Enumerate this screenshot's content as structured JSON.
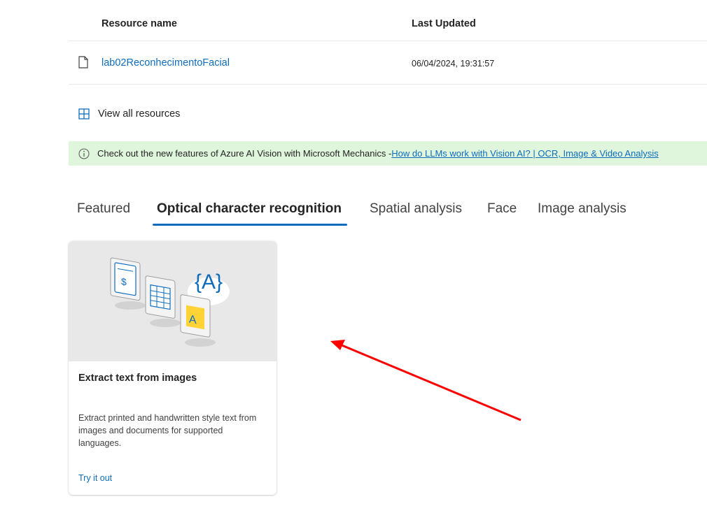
{
  "table": {
    "headers": {
      "resource_name": "Resource name",
      "last_updated": "Last Updated"
    },
    "rows": [
      {
        "name": "lab02ReconhecimentoFacial",
        "updated": "06/04/2024, 19:31:57",
        "icon": "file-icon"
      }
    ]
  },
  "view_all": {
    "label": "View all resources",
    "icon": "grid-icon"
  },
  "banner": {
    "icon": "info-icon",
    "text": "Check out the new features of Azure AI Vision with Microsoft Mechanics - ",
    "link": "How do LLMs work with Vision AI? | OCR, Image & Video Analysis",
    "background": "#dff6dd"
  },
  "tabs": [
    {
      "label": "Featured",
      "active": false
    },
    {
      "label": "Optical character recognition",
      "active": true
    },
    {
      "label": "Spatial analysis",
      "active": false
    },
    {
      "label": "Face",
      "active": false
    },
    {
      "label": "Image analysis",
      "active": false
    }
  ],
  "card": {
    "title": "Extract text from images",
    "description": "Extract printed and handwritten style text from images and documents for supported languages.",
    "link": "Try it out",
    "illustration": "ocr-documents-illustration"
  },
  "annotation": {
    "type": "red-arrow",
    "color": "#ff0000"
  },
  "colors": {
    "accent": "#0f6cbd",
    "text": "#242424"
  }
}
